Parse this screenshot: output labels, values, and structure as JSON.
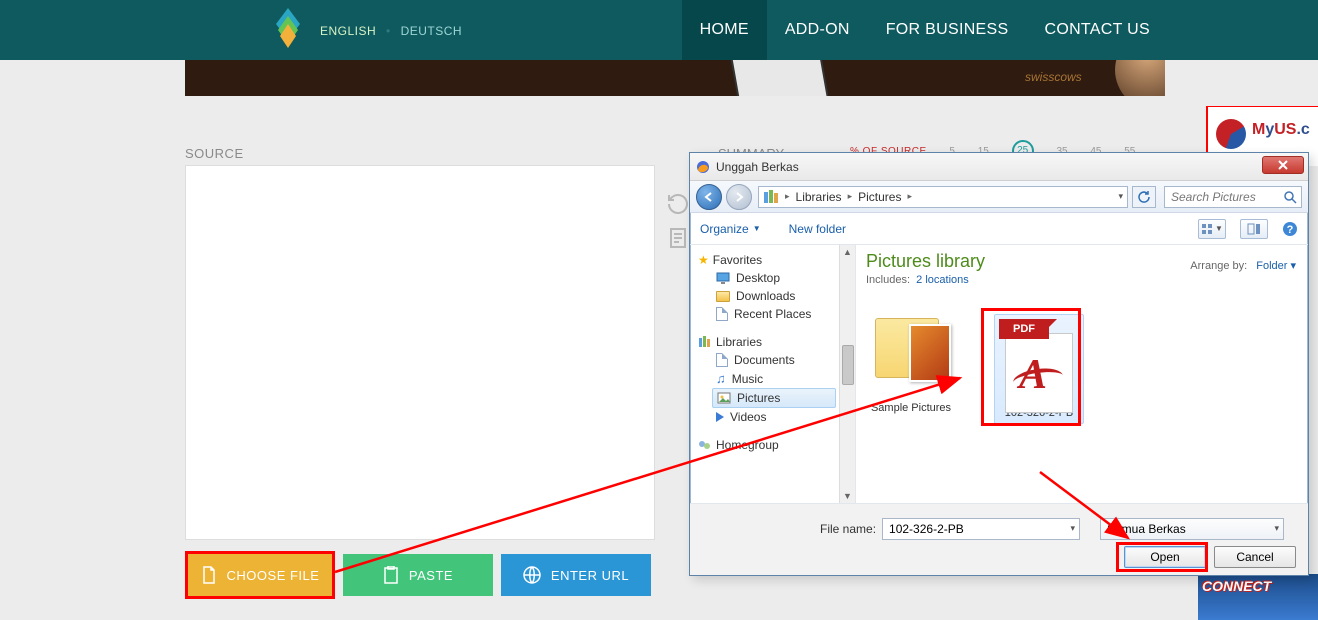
{
  "nav": {
    "lang_active": "ENGLISH",
    "lang_other": "DEUTSCH",
    "items": [
      "HOME",
      "ADD-ON",
      "FOR BUSINESS",
      "CONTACT US"
    ]
  },
  "hero": {
    "swisscows": "swisscows"
  },
  "page": {
    "source_label": "SOURCE",
    "summary_label": "SUMMARY",
    "pct_label": "% OF SOURCE",
    "slider_ticks": [
      "5",
      "15",
      "25",
      "35",
      "45",
      "55"
    ]
  },
  "buttons": {
    "choose": "CHOOSE FILE",
    "paste": "PASTE",
    "url": "ENTER URL"
  },
  "ads": {
    "myus": "MyUS.c",
    "connect4": "CONNECT"
  },
  "dialog": {
    "title": "Unggah Berkas",
    "breadcrumb": [
      "Libraries",
      "Pictures"
    ],
    "search_placeholder": "Search Pictures",
    "toolbar": {
      "organize": "Organize",
      "new_folder": "New folder"
    },
    "tree": {
      "favorites": "Favorites",
      "fav_items": [
        "Desktop",
        "Downloads",
        "Recent Places"
      ],
      "libraries": "Libraries",
      "lib_items": [
        "Documents",
        "Music",
        "Pictures",
        "Videos"
      ],
      "homegroup": "Homegroup"
    },
    "library": {
      "title": "Pictures library",
      "includes_label": "Includes:",
      "includes_link": "2 locations",
      "arrange_label": "Arrange by:",
      "arrange_value": "Folder"
    },
    "files": {
      "sample_pictures": "Sample Pictures",
      "pdf_name": "102-326-2-PB",
      "pdf_badge": "PDF"
    },
    "footer": {
      "filename_label": "File name:",
      "filename_value": "102-326-2-PB",
      "filter": "Semua Berkas",
      "open": "Open",
      "cancel": "Cancel"
    }
  }
}
